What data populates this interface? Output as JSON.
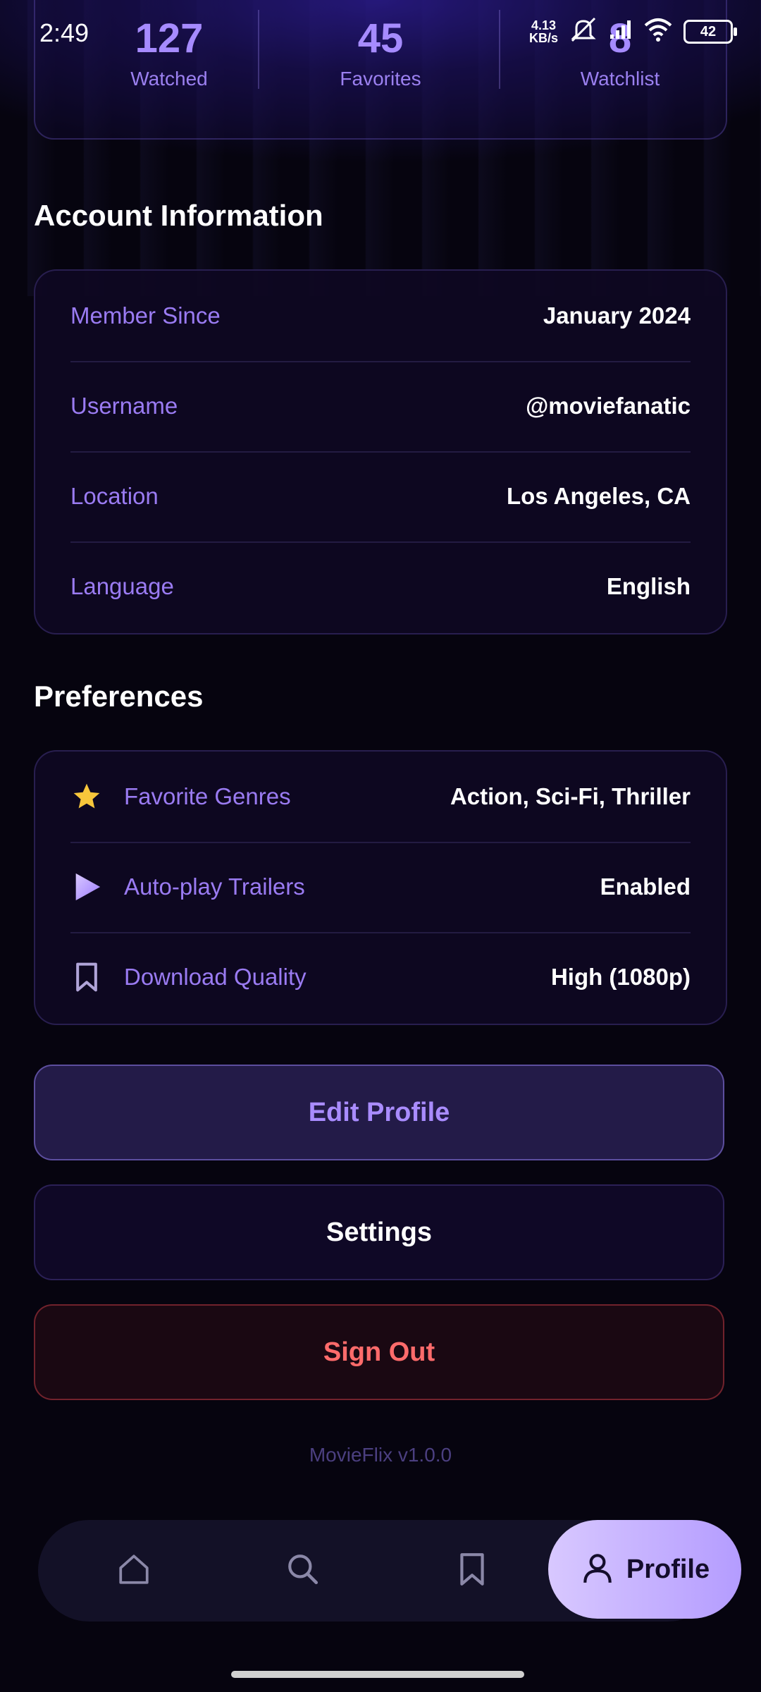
{
  "status_bar": {
    "time": "2:49",
    "net_speed_value": "4.13",
    "net_speed_unit": "KB/s",
    "battery": "42"
  },
  "stats": [
    {
      "value": "127",
      "label": "Watched"
    },
    {
      "value": "45",
      "label": "Favorites"
    },
    {
      "value": "8",
      "label": "Watchlist"
    }
  ],
  "account": {
    "title": "Account Information",
    "rows": [
      {
        "label": "Member Since",
        "value": "January 2024"
      },
      {
        "label": "Username",
        "value": "@moviefanatic"
      },
      {
        "label": "Location",
        "value": "Los Angeles, CA"
      },
      {
        "label": "Language",
        "value": "English"
      }
    ]
  },
  "preferences": {
    "title": "Preferences",
    "rows": [
      {
        "icon": "star-icon",
        "label": "Favorite Genres",
        "value": "Action, Sci-Fi, Thriller"
      },
      {
        "icon": "play-icon",
        "label": "Auto-play Trailers",
        "value": "Enabled"
      },
      {
        "icon": "bookmark-icon",
        "label": "Download Quality",
        "value": "High (1080p)"
      }
    ]
  },
  "buttons": {
    "edit_profile": "Edit Profile",
    "settings": "Settings",
    "sign_out": "Sign Out"
  },
  "version": "MovieFlix v1.0.0",
  "nav": {
    "items": [
      "home-icon",
      "search-icon",
      "bookmark-icon",
      "profile-icon"
    ],
    "active_label": "Profile"
  },
  "colors": {
    "accent": "#a68bff",
    "danger": "#ff6b6b",
    "background": "#06040f"
  }
}
